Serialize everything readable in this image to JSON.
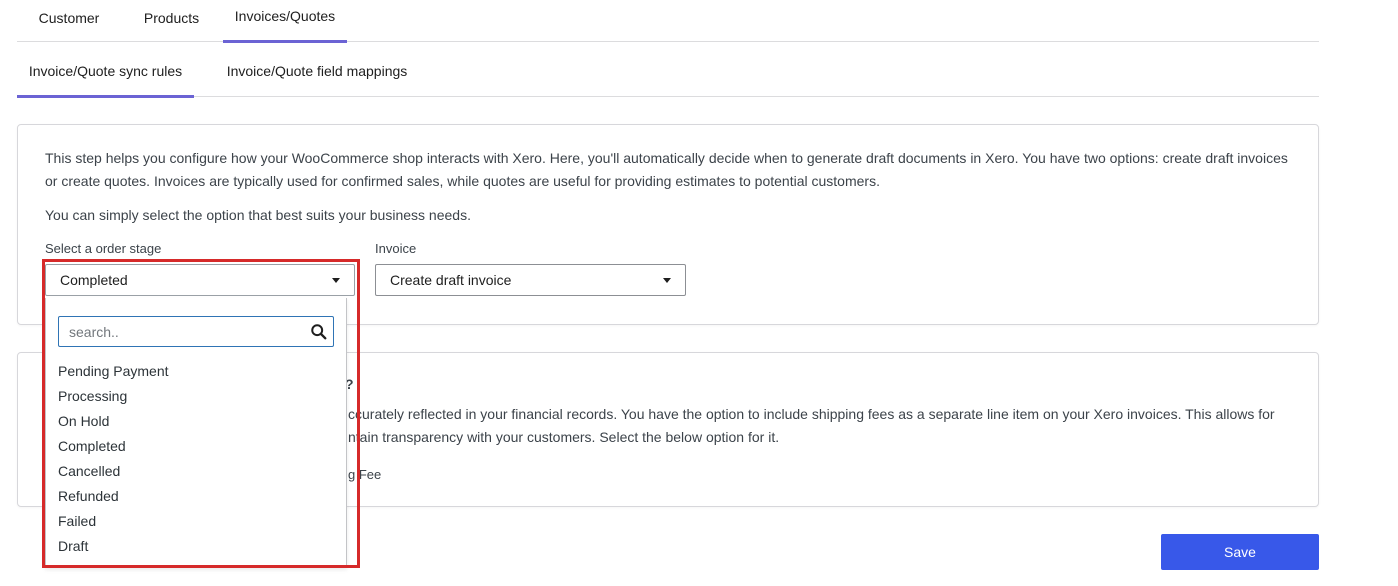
{
  "top_tabs": {
    "customer": "Customer",
    "products": "Products",
    "invoices": "Invoices/Quotes"
  },
  "sub_tabs": {
    "sync_rules": "Invoice/Quote sync rules",
    "field_mappings": "Invoice/Quote field mappings"
  },
  "sync_card": {
    "description": "This step helps you configure how your WooCommerce shop interacts with Xero. Here, you'll automatically decide when to generate draft documents in Xero. You have two options: create draft invoices or create quotes. Invoices are typically used for confirmed sales, while quotes are useful for providing estimates to potential customers.",
    "hint": "You can simply select the option that best suits your business needs.",
    "stage_label": "Select a order stage",
    "stage_value": "Completed",
    "invoice_label": "Invoice",
    "invoice_value": "Create draft invoice"
  },
  "shipping_card": {
    "title_fragment": "?",
    "text_line1": "ccurately reflected in your financial records. You have the option to include shipping fees as a separate line item on your Xero invoices. This allows for",
    "text_line2": "ntain transparency with your customers. Select the below option for it.",
    "option_fragment": "g Fee"
  },
  "dropdown": {
    "search_placeholder": "search..",
    "options": [
      "Pending Payment",
      "Processing",
      "On Hold",
      "Completed",
      "Cancelled",
      "Refunded",
      "Failed",
      "Draft"
    ]
  },
  "actions": {
    "save": "Save"
  },
  "colors": {
    "accent_tab": "#6b63d4",
    "primary_button": "#3858e9",
    "highlight_box": "#d62a2a",
    "search_border": "#2f74b5"
  }
}
